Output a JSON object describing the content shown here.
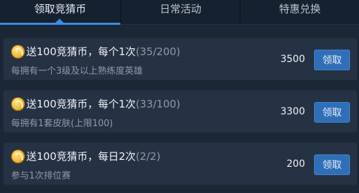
{
  "tabs": [
    {
      "label": "领取竞猜币",
      "active": true
    },
    {
      "label": "日常活动",
      "active": false
    },
    {
      "label": "特惠兑换",
      "active": false
    }
  ],
  "tasks": [
    {
      "title": "送100竞猜币，每个1次",
      "progress": "(35/200)",
      "desc": "每拥有一个3级及以上熟练度英雄",
      "amount": "3500",
      "button": "领取"
    },
    {
      "title": "送100竞猜币，每个1次",
      "progress": "(33/100)",
      "desc": "每拥有1套皮肤(上限100)",
      "amount": "3300",
      "button": "领取"
    },
    {
      "title": "送100竞猜币，每日2次",
      "progress": "(2/2)",
      "desc": "参与1次排位赛",
      "amount": "200",
      "button": "领取"
    }
  ],
  "colors": {
    "accent": "#3a8ee6",
    "button": "#2f6fb7",
    "background": "#1c2735",
    "card": "#253243"
  },
  "icons": {
    "task_icon": "gold-coin-icon"
  }
}
